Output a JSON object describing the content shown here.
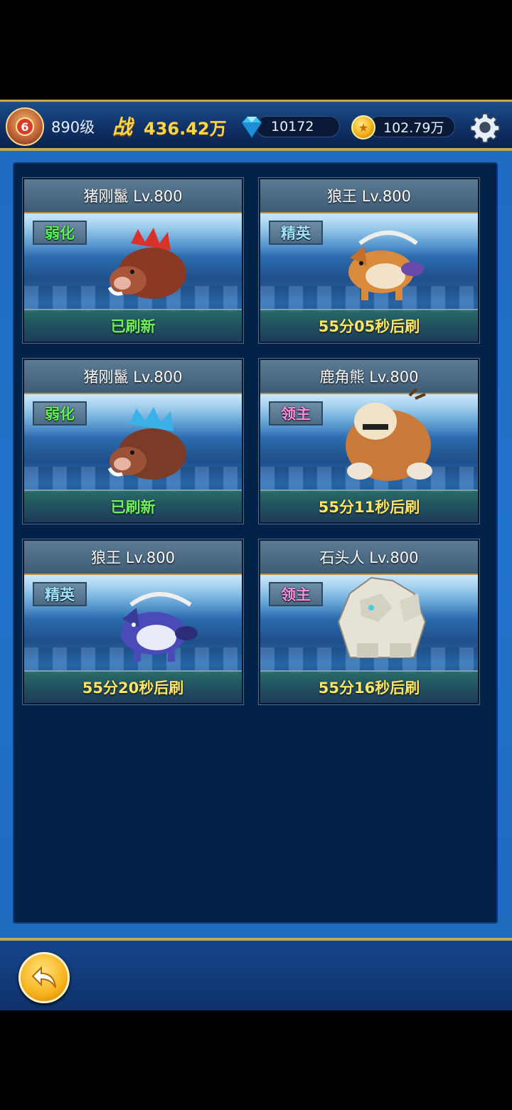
{
  "header": {
    "rank_badge": "6",
    "level": "890级",
    "power_icon": "战",
    "power_value": "436.42万",
    "gems": "10172",
    "gold": "102.79万",
    "icons": [
      "rank-badge-icon",
      "diamond-icon",
      "gold-coin-icon",
      "gear-icon"
    ],
    "colors": {
      "power": "#ffd54a",
      "frame": "#c9a451"
    }
  },
  "cards": [
    {
      "title": "猪刚鬣 Lv.800",
      "tag": "弱化",
      "status": "已刷新",
      "monster": "red-boar"
    },
    {
      "title": "狼王 Lv.800",
      "tag": "精英",
      "status": "55分05秒后刷",
      "monster": "orange-wolf"
    },
    {
      "title": "猪刚鬣 Lv.800",
      "tag": "弱化",
      "status": "已刷新",
      "monster": "blue-boar"
    },
    {
      "title": "鹿角熊 Lv.800",
      "tag": "领主",
      "status": "55分11秒后刷",
      "monster": "antler-bear"
    },
    {
      "title": "狼王 Lv.800",
      "tag": "精英",
      "status": "55分20秒后刷",
      "monster": "blue-wolf"
    },
    {
      "title": "石头人 Lv.800",
      "tag": "领主",
      "status": "55分16秒后刷",
      "monster": "stone-golem"
    }
  ],
  "footer": {
    "back_icon": "back-arrow-icon"
  }
}
